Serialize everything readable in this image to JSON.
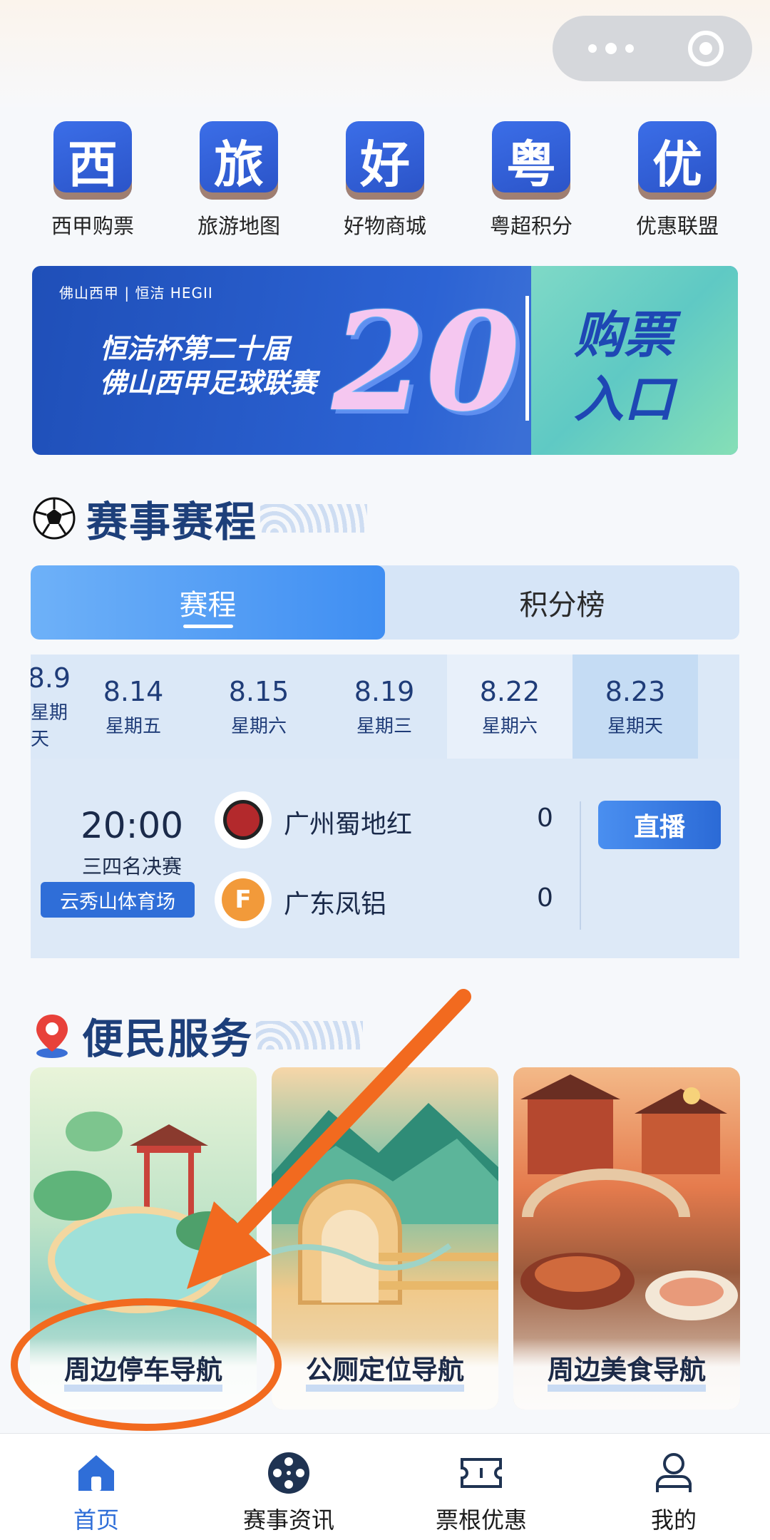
{
  "quick_entries": [
    {
      "label": "西甲购票",
      "glyph": "西"
    },
    {
      "label": "旅游地图",
      "glyph": "旅"
    },
    {
      "label": "好物商城",
      "glyph": "好"
    },
    {
      "label": "粤超积分",
      "glyph": "粤"
    },
    {
      "label": "优惠联盟",
      "glyph": "优"
    }
  ],
  "banner": {
    "logos": "佛山西甲 | 恒洁 HEGII",
    "title_line1": "恒洁杯第二十届",
    "title_line2": "佛山西甲足球联赛",
    "big_number": "20",
    "cta_line1": "购票",
    "cta_line2": "入口"
  },
  "schedule": {
    "title": "赛事赛程",
    "tabs": [
      {
        "label": "赛程"
      },
      {
        "label": "积分榜"
      }
    ],
    "dates": [
      {
        "date": "8.9",
        "weekday": "星期天"
      },
      {
        "date": "8.14",
        "weekday": "星期五"
      },
      {
        "date": "8.15",
        "weekday": "星期六"
      },
      {
        "date": "8.19",
        "weekday": "星期三"
      },
      {
        "date": "8.22",
        "weekday": "星期六"
      },
      {
        "date": "8.23",
        "weekday": "星期天"
      }
    ],
    "match": {
      "time": "20:00",
      "round": "三四名决赛",
      "venue": "云秀山体育场",
      "home_team": "广州蜀地红",
      "home_score": "0",
      "away_team": "广东凤铝",
      "away_score": "0",
      "away_logo_letter": "F",
      "live_label": "直播"
    }
  },
  "services": {
    "title": "便民服务",
    "cards": [
      {
        "label": "周边停车导航"
      },
      {
        "label": "公厕定位导航"
      },
      {
        "label": "周边美食导航"
      }
    ]
  },
  "bottom_nav": [
    {
      "label": "首页",
      "icon": "home-icon"
    },
    {
      "label": "赛事资讯",
      "icon": "film-reel-icon"
    },
    {
      "label": "票根优惠",
      "icon": "ticket-icon"
    },
    {
      "label": "我的",
      "icon": "user-icon"
    }
  ],
  "colors": {
    "accent": "#2f6ed8",
    "annotation": "#f26a1f"
  }
}
